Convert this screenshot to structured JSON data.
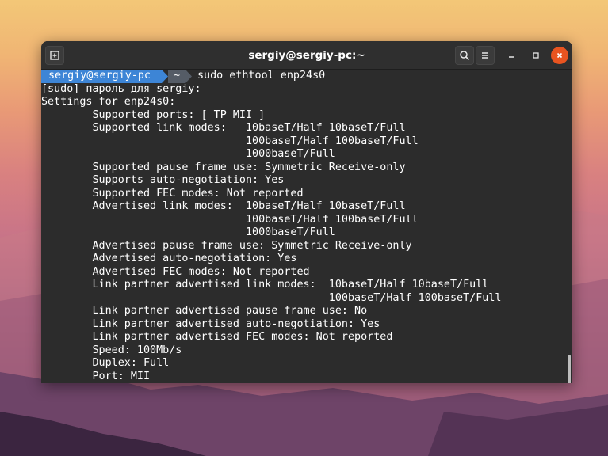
{
  "window": {
    "title": "sergiy@sergiy-pc:~"
  },
  "prompt": {
    "user_host": "sergiy@sergiy-pc",
    "directory": "~",
    "command": "sudo ethtool enp24s0"
  },
  "output": [
    "[sudo] пароль для sergiy:",
    "Settings for enp24s0:",
    "        Supported ports: [ TP MII ]",
    "        Supported link modes:   10baseT/Half 10baseT/Full",
    "                                100baseT/Half 100baseT/Full",
    "                                1000baseT/Full",
    "        Supported pause frame use: Symmetric Receive-only",
    "        Supports auto-negotiation: Yes",
    "        Supported FEC modes: Not reported",
    "        Advertised link modes:  10baseT/Half 10baseT/Full",
    "                                100baseT/Half 100baseT/Full",
    "                                1000baseT/Full",
    "        Advertised pause frame use: Symmetric Receive-only",
    "        Advertised auto-negotiation: Yes",
    "        Advertised FEC modes: Not reported",
    "        Link partner advertised link modes:  10baseT/Half 10baseT/Full",
    "                                             100baseT/Half 100baseT/Full",
    "        Link partner advertised pause frame use: No",
    "        Link partner advertised auto-negotiation: Yes",
    "        Link partner advertised FEC modes: Not reported",
    "        Speed: 100Mb/s",
    "        Duplex: Full",
    "        Port: MII"
  ],
  "colors": {
    "prompt_user_bg": "#3d85d6",
    "prompt_dir_bg": "#555c66",
    "terminal_bg": "#2c2c2c",
    "close_button": "#e95420"
  },
  "icons": {
    "new_tab": "new-tab-icon",
    "search": "search-icon",
    "menu": "hamburger-menu-icon",
    "minimize": "minimize-icon",
    "maximize": "maximize-icon",
    "close": "close-icon"
  }
}
